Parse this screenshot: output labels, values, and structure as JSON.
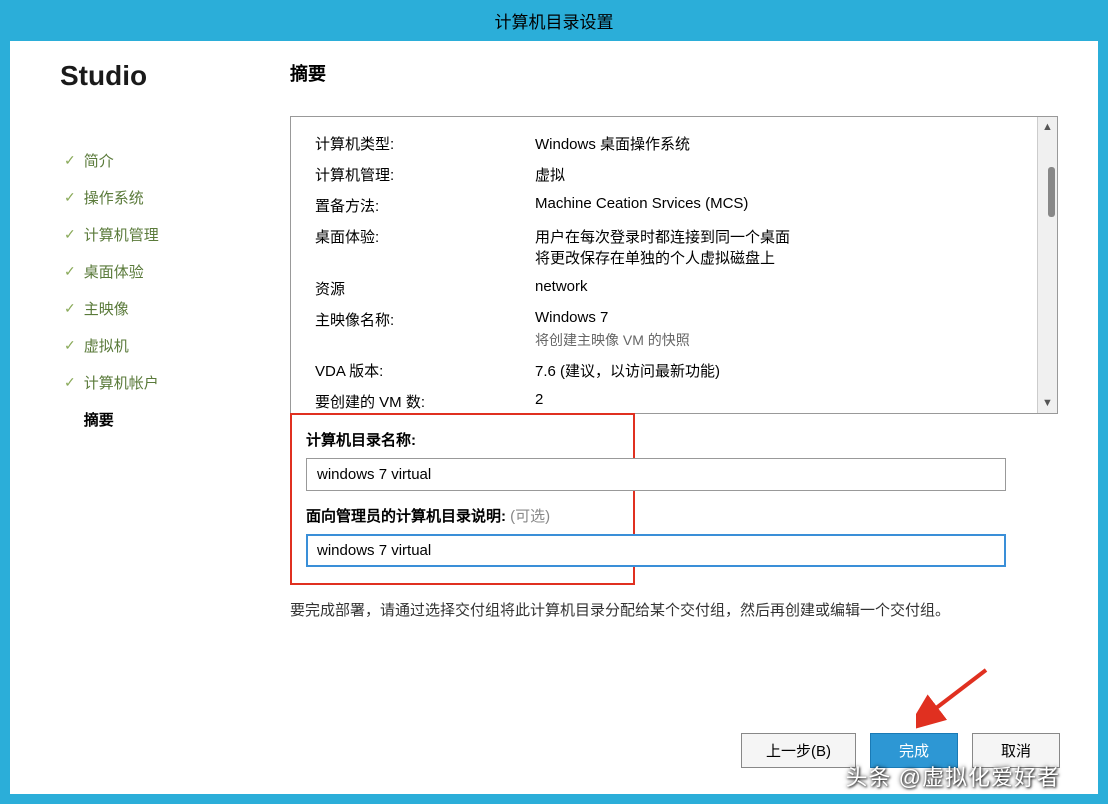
{
  "window": {
    "title": "计算机目录设置"
  },
  "sidebar": {
    "title": "Studio",
    "items": [
      {
        "label": "简介",
        "done": true
      },
      {
        "label": "操作系统",
        "done": true
      },
      {
        "label": "计算机管理",
        "done": true
      },
      {
        "label": "桌面体验",
        "done": true
      },
      {
        "label": "主映像",
        "done": true
      },
      {
        "label": "虚拟机",
        "done": true
      },
      {
        "label": "计算机帐户",
        "done": true
      },
      {
        "label": "摘要",
        "done": false,
        "active": true
      }
    ]
  },
  "main": {
    "heading": "摘要",
    "summary": [
      {
        "label": "计算机类型:",
        "value": "Windows 桌面操作系统"
      },
      {
        "label": "计算机管理:",
        "value": "虚拟"
      },
      {
        "label": "置备方法:",
        "value": "Machine Ceation Srvices (MCS)"
      },
      {
        "label": "桌面体验:",
        "value": "用户在每次登录时都连接到同一个桌面",
        "sub": "将更改保存在单独的个人虚拟磁盘上"
      },
      {
        "label": "资源",
        "value": "network"
      },
      {
        "label": "主映像名称:",
        "value": "Windows 7",
        "sub": "将创建主映像 VM 的快照"
      },
      {
        "label": "VDA 版本:",
        "value": "7.6 (建议，以访问最新功能)"
      },
      {
        "label": "要创建的 VM 数:",
        "value": "2"
      }
    ],
    "form": {
      "catalog_name_label": "计算机目录名称:",
      "catalog_name_value": "windows 7 virtual",
      "description_label": "面向管理员的计算机目录说明:",
      "description_optional": "(可选)",
      "description_value": "windows 7 virtual"
    },
    "note": "要完成部署，请通过选择交付组将此计算机目录分配给某个交付组，然后再创建或编辑一个交付组。"
  },
  "buttons": {
    "back": "上一步(B)",
    "finish": "完成",
    "cancel": "取消"
  },
  "watermark": "头条 @虚拟化爱好者"
}
